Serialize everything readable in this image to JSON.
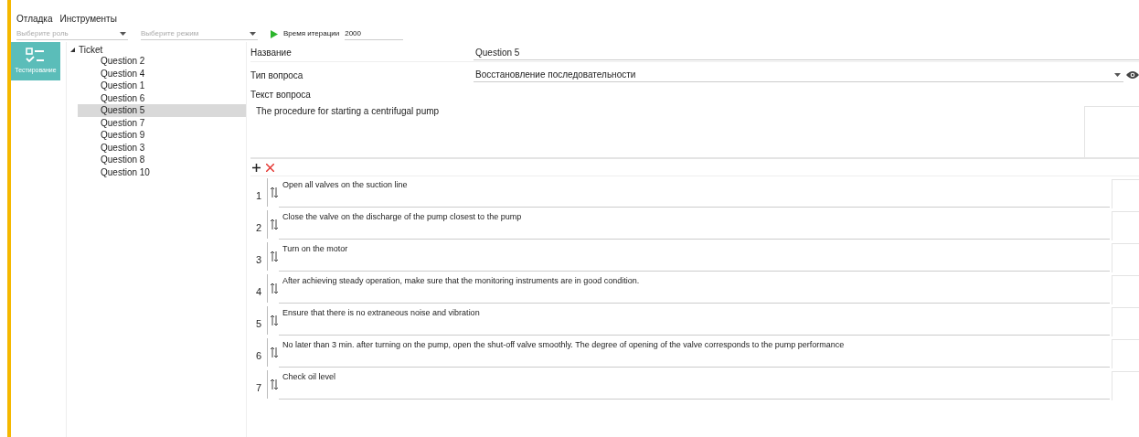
{
  "menu": [
    "Отладка",
    "Инструменты"
  ],
  "toolbar": {
    "role_select": {
      "placeholder": "Выберите роль"
    },
    "mode_select": {
      "placeholder": "Выберите режим"
    },
    "iteration_label": "Время итерации",
    "iteration_value": "2000"
  },
  "nav": [
    {
      "label": "Тестирование",
      "selected": true
    }
  ],
  "tree": {
    "label": "Ticket",
    "expanded": true,
    "children": [
      {
        "label": "Question 2",
        "selected": false
      },
      {
        "label": "Question 4",
        "selected": false
      },
      {
        "label": "Question 1",
        "selected": false
      },
      {
        "label": "Question 6",
        "selected": false
      },
      {
        "label": "Question 5",
        "selected": true
      },
      {
        "label": "Question 7",
        "selected": false
      },
      {
        "label": "Question 9",
        "selected": false
      },
      {
        "label": "Question 3",
        "selected": false
      },
      {
        "label": "Question 8",
        "selected": false
      },
      {
        "label": "Question 10",
        "selected": false
      }
    ]
  },
  "form": {
    "name_label": "Название",
    "name_value": "Question 5",
    "type_label": "Тип вопроса",
    "type_value": "Восстановление последовательности",
    "text_label": "Текст вопроса",
    "text_value": "The procedure for starting a centrifugal pump"
  },
  "answers": [
    {
      "number": "1",
      "text": "Open all valves on the suction line"
    },
    {
      "number": "2",
      "text": "Close the valve on the discharge of the pump closest to the pump"
    },
    {
      "number": "3",
      "text": "Turn on the motor"
    },
    {
      "number": "4",
      "text": "After achieving steady operation, make sure that the monitoring instruments are in good condition."
    },
    {
      "number": "5",
      "text": "Ensure that there is no extraneous noise and vibration"
    },
    {
      "number": "6",
      "text": "No later than 3 min. after turning on the pump, open the shut-off valve smoothly. The degree of opening of the valve corresponds to the pump performance"
    },
    {
      "number": "7",
      "text": "Check oil level"
    }
  ]
}
